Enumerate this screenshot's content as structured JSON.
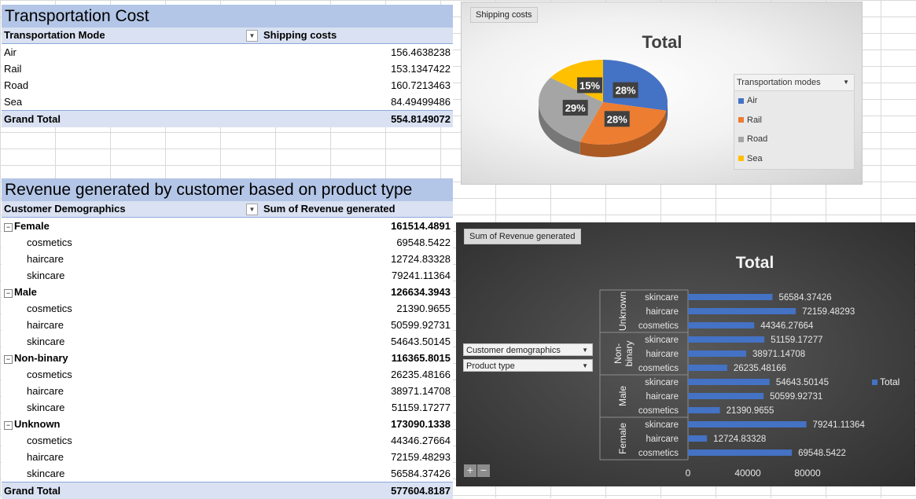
{
  "transport_table": {
    "title": "Transportation Cost",
    "col1": "Transportation Mode",
    "col2": "Shipping costs",
    "rows": [
      {
        "label": "Air",
        "value": "156.4638238"
      },
      {
        "label": "Rail",
        "value": "153.1347422"
      },
      {
        "label": "Road",
        "value": "160.7213463"
      },
      {
        "label": "Sea",
        "value": "84.49499486"
      }
    ],
    "total_label": "Grand Total",
    "total_value": "554.8149072"
  },
  "revenue_table": {
    "title": "Revenue generated by customer  based on product  type",
    "col1": "Customer Demographics",
    "col2": "Sum of Revenue generated",
    "groups": [
      {
        "label": "Female",
        "value": "161514.4891",
        "items": [
          {
            "label": "cosmetics",
            "value": "69548.5422"
          },
          {
            "label": "haircare",
            "value": "12724.83328"
          },
          {
            "label": "skincare",
            "value": "79241.11364"
          }
        ]
      },
      {
        "label": "Male",
        "value": "126634.3943",
        "items": [
          {
            "label": "cosmetics",
            "value": "21390.9655"
          },
          {
            "label": "haircare",
            "value": "50599.92731"
          },
          {
            "label": "skincare",
            "value": "54643.50145"
          }
        ]
      },
      {
        "label": "Non-binary",
        "value": "116365.8015",
        "items": [
          {
            "label": "cosmetics",
            "value": "26235.48166"
          },
          {
            "label": "haircare",
            "value": "38971.14708"
          },
          {
            "label": "skincare",
            "value": "51159.17277"
          }
        ]
      },
      {
        "label": "Unknown",
        "value": "173090.1338",
        "items": [
          {
            "label": "cosmetics",
            "value": "44346.27664"
          },
          {
            "label": "haircare",
            "value": "72159.48293"
          },
          {
            "label": "skincare",
            "value": "56584.37426"
          }
        ]
      }
    ],
    "total_label": "Grand Total",
    "total_value": "577604.8187"
  },
  "chart_data": [
    {
      "type": "pie",
      "title": "Total",
      "field_button": "Shipping costs",
      "legend_title": "Transportation modes",
      "categories": [
        "Air",
        "Rail",
        "Road",
        "Sea"
      ],
      "values": [
        156.4638238,
        153.1347422,
        160.7213463,
        84.49499486
      ],
      "labels": [
        "28%",
        "28%",
        "29%",
        "15%"
      ],
      "colors": [
        "#4472c4",
        "#ed7d31",
        "#a5a5a5",
        "#ffc000"
      ],
      "legend_position": "right"
    },
    {
      "type": "bar",
      "orientation": "horizontal",
      "title": "Total",
      "field_button": "Sum of Revenue generated",
      "slicers": [
        "Customer demographics",
        "Product type"
      ],
      "legend": [
        "Total"
      ],
      "color": "#4472c4",
      "groups": [
        {
          "name": "Unknown",
          "categories": [
            "skincare",
            "haircare",
            "cosmetics"
          ],
          "values": [
            56584.37426,
            72159.48293,
            44346.27664
          ],
          "labels": [
            "56584.37426",
            "72159.48293",
            "44346.27664"
          ]
        },
        {
          "name": "Non-binary",
          "categories": [
            "skincare",
            "haircare",
            "cosmetics"
          ],
          "values": [
            51159.17277,
            38971.14708,
            26235.48166
          ],
          "labels": [
            "51159.17277",
            "38971.14708",
            "26235.48166"
          ]
        },
        {
          "name": "Male",
          "categories": [
            "skincare",
            "haircare",
            "cosmetics"
          ],
          "values": [
            54643.50145,
            50599.92731,
            21390.9655
          ],
          "labels": [
            "54643.50145",
            "50599.92731",
            "21390.9655"
          ]
        },
        {
          "name": "Female",
          "categories": [
            "skincare",
            "haircare",
            "cosmetics"
          ],
          "values": [
            79241.11364,
            12724.83328,
            69548.5422
          ],
          "labels": [
            "79241.11364",
            "12724.83328",
            "69548.5422"
          ]
        }
      ],
      "xlim": [
        0,
        100000
      ],
      "xticks": [
        0,
        40000,
        80000
      ],
      "xtick_labels": [
        "0",
        "40000",
        "80000"
      ],
      "legend_position": "right"
    }
  ]
}
